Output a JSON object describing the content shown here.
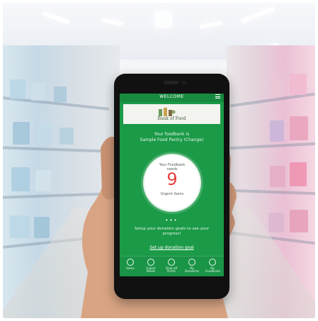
{
  "screen": {
    "header_title": "WELCOME",
    "brand_name": "Bank of Food",
    "subtitle_line1": "Your foodbank is",
    "subtitle_line2": "Sample Food Pantry (Change)",
    "circle_title_line1": "Your Foodbank",
    "circle_title_line2": "needs",
    "count": "9",
    "count_label": "Urgent items",
    "goal_line1": "Setup your donation goals to see your",
    "goal_line2": "progress!",
    "goal_link": "Set up donation goal"
  },
  "tabs": [
    {
      "label": "Home"
    },
    {
      "label": "Urgent Needs"
    },
    {
      "label": "Drop-off Points"
    },
    {
      "label": "My Donations"
    },
    {
      "label": "My Foodbanks"
    }
  ],
  "colors": {
    "app_green": "#1b9a47",
    "number_red": "#e63f3b"
  }
}
